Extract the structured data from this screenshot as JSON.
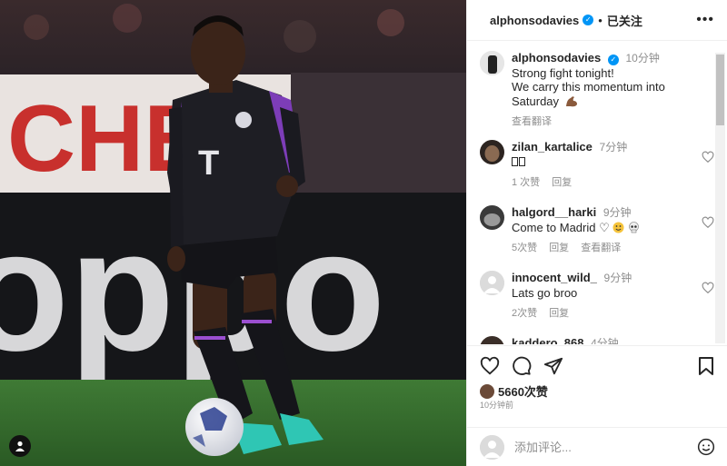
{
  "header": {
    "username": "alphonsodavies",
    "verified_mark": "✓",
    "separator": "•",
    "follow_label": "已关注",
    "more_label": "•••"
  },
  "photo": {
    "banner_text": "CHE",
    "ad_text": "oppo",
    "jersey_logo": "T"
  },
  "caption": {
    "username": "alphonsodavies",
    "time": "10分钟",
    "line1": "Strong fight tonight!",
    "line2": "We carry this momentum into",
    "line3": "Saturday",
    "see_translation": "查看翻译"
  },
  "comments": [
    {
      "username": "zilan_kartalice",
      "time": "7分钟",
      "text": "\u0000\u0000",
      "likes": "1 次赞",
      "reply": "回复",
      "translate": ""
    },
    {
      "username": "halgord__harki",
      "time": "9分钟",
      "text": "Come to Madrid ♡",
      "likes": "5次赞",
      "reply": "回复",
      "translate": "查看翻译"
    },
    {
      "username": "innocent_wild_",
      "time": "9分钟",
      "text": "Lats go broo",
      "likes": "2次赞",
      "reply": "回复",
      "translate": ""
    },
    {
      "username": "kaddero_868",
      "time": "4分钟",
      "text": "",
      "likes": "",
      "reply": "",
      "translate": ""
    }
  ],
  "actions": {
    "likes_count": "5660次赞",
    "post_time": "10分钟前"
  },
  "add_comment": {
    "placeholder": "添加评论..."
  },
  "colors": {
    "accent": "#0095f6",
    "muted": "#8e8e8e",
    "text": "#262626"
  }
}
